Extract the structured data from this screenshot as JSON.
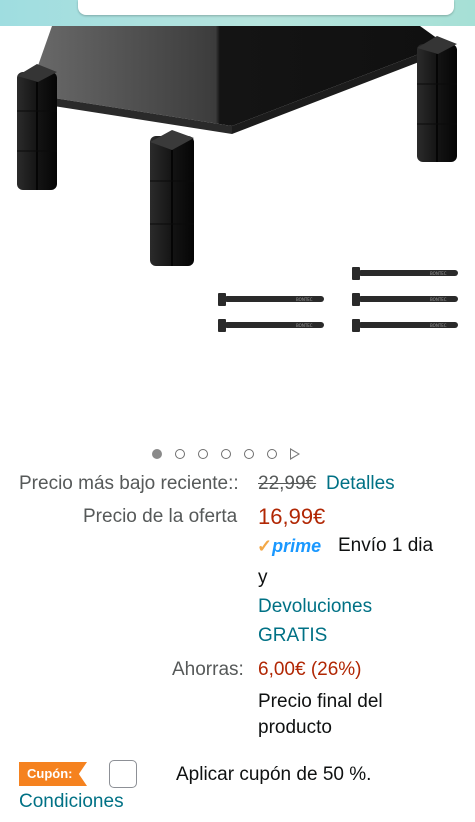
{
  "pricing": {
    "lowest_recent_label": "Precio más bajo reciente::",
    "list_price": "22,99€",
    "details_link": "Detalles",
    "offer_label": "Precio de la oferta",
    "offer_price": "16,99€",
    "prime_logo": "prime",
    "shipping_text": "Envío 1 dia",
    "conjunction": "y",
    "returns_line1": "Devoluciones",
    "returns_line2": "GRATIS",
    "savings_label": "Ahorras:",
    "savings_value": "6,00€ (26%)",
    "final_price_line1": "Precio final del",
    "final_price_line2": "producto"
  },
  "coupon": {
    "badge": "Cupón:",
    "apply_text": "Aplicar cupón de 50 %.",
    "conditions_link": "Condiciones"
  },
  "carousel": {
    "total_images": 6,
    "active_index": 0
  },
  "product_image": {
    "cable_tie_brand": "BONTEC"
  },
  "colors": {
    "price": "#b12704",
    "link": "#007185",
    "prime": "#1a98ff",
    "coupon_badge": "#f5821f",
    "header": "#a6e0d6"
  }
}
